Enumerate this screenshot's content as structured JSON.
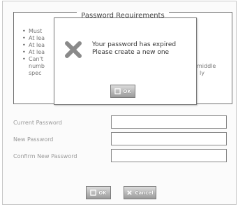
{
  "requirements": {
    "title": "Password Requirements",
    "items": [
      "Must",
      "At lea",
      "At lea",
      "At lea",
      "Can't"
    ],
    "continuation": [
      "numb",
      "spec"
    ],
    "right_fragments": [
      "middle",
      "ly"
    ]
  },
  "dialog": {
    "icon": "error-x-icon",
    "message_line1": "Your password has expired",
    "message_line2": "Please create a new one",
    "ok_label": "OK"
  },
  "form": {
    "current_label": "Current Password",
    "new_label": "New Password",
    "confirm_label": "Confirm New Password",
    "current_value": "",
    "new_value": "",
    "confirm_value": ""
  },
  "buttons": {
    "ok_label": "OK",
    "cancel_label": "Cancel"
  },
  "colors": {
    "error_icon": "#8a8a8a",
    "button_gradient_top": "#dcdcdc",
    "button_gradient_bottom": "#9a9a9a"
  }
}
